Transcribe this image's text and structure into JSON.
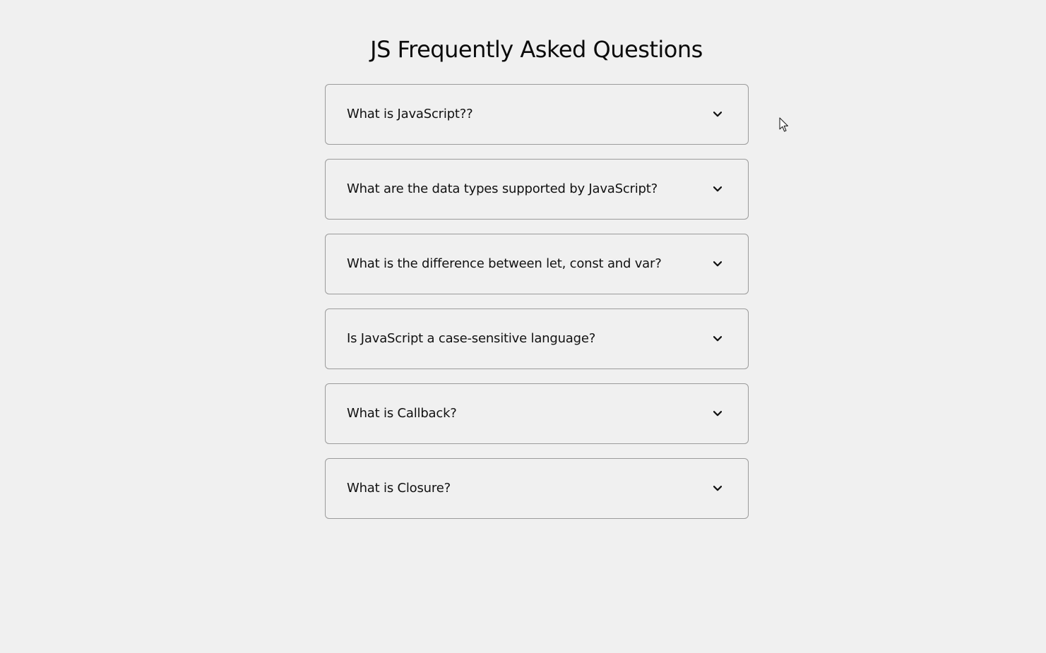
{
  "page": {
    "title": "JS Frequently Asked Questions"
  },
  "faq": {
    "items": [
      {
        "question": "What is JavaScript??",
        "expanded": false
      },
      {
        "question": "What are the data types supported by JavaScript?",
        "expanded": false
      },
      {
        "question": "What is the difference between let, const and var?",
        "expanded": false
      },
      {
        "question": "Is JavaScript a case-sensitive language?",
        "expanded": false
      },
      {
        "question": "What is Callback?",
        "expanded": false
      },
      {
        "question": "What is Closure?",
        "expanded": false
      }
    ]
  },
  "icons": {
    "toggle": "chevron-down-icon",
    "pointer": "mouse-cursor-icon"
  },
  "colors": {
    "background": "#f0f0f0",
    "card_border": "#9b9b9b",
    "text": "#111111"
  }
}
